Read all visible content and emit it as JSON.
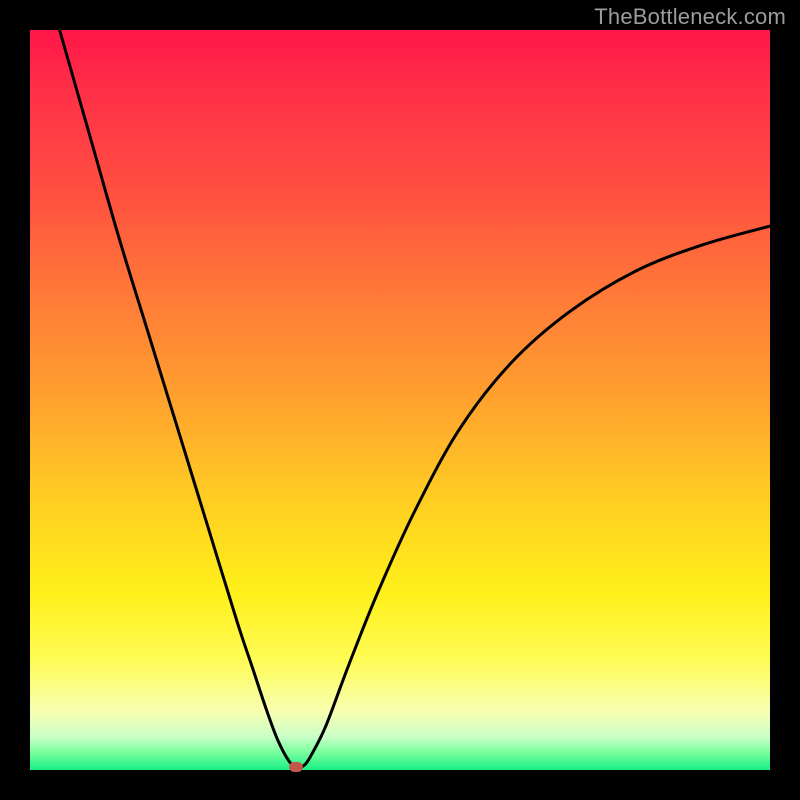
{
  "watermark": "TheBottleneck.com",
  "chart_data": {
    "type": "line",
    "title": "",
    "xlabel": "",
    "ylabel": "",
    "xlim": [
      0,
      100
    ],
    "ylim": [
      0,
      100
    ],
    "series": [
      {
        "name": "bottleneck-curve",
        "x": [
          4,
          8,
          12,
          16,
          20,
          24,
          28,
          30,
          32,
          33.5,
          35,
          36,
          37,
          38,
          40,
          43,
          47,
          52,
          58,
          65,
          73,
          82,
          91,
          100
        ],
        "y": [
          100,
          86,
          72,
          59,
          46,
          33,
          20,
          14,
          8,
          4,
          1.2,
          0.4,
          0.6,
          2,
          6,
          14,
          24,
          35,
          46,
          55,
          62,
          67.5,
          71,
          73.5
        ]
      }
    ],
    "marker": {
      "x": 36,
      "y": 0.4,
      "color": "#c4574b"
    },
    "background_gradient": {
      "top": "#ff1648",
      "mid": "#ffd020",
      "bottom": "#19ef84"
    },
    "axes_visible": false,
    "grid": false
  }
}
